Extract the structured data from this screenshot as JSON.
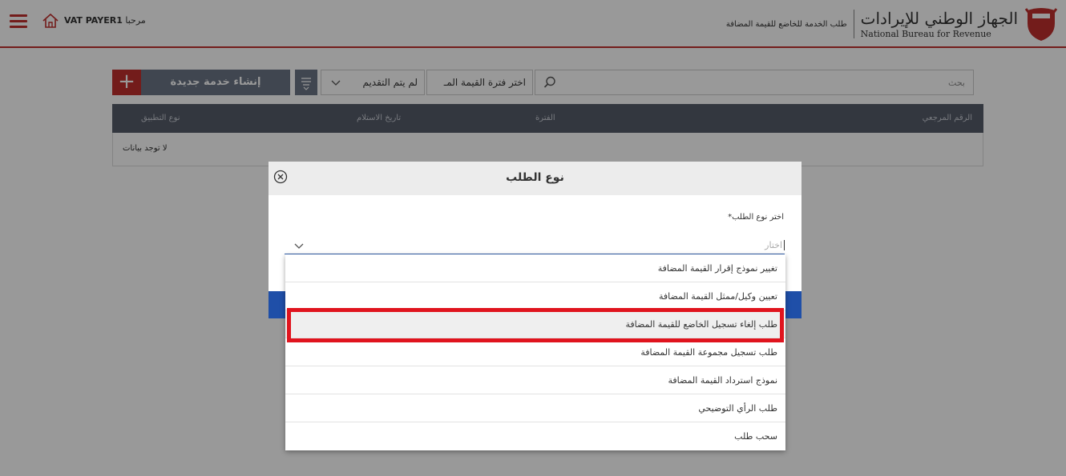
{
  "header": {
    "greeting_prefix": "مرحبا",
    "user_name": "VAT PAYER1",
    "service_title": "طلب الخدمة للخاضع للقيمة المضافة",
    "logo_ar": "الجهاز الوطني للإيرادات",
    "logo_en": "National Bureau for Revenue"
  },
  "toolbar": {
    "search_placeholder": "بحث",
    "period_value": "اختر فترة القيمة المـ",
    "status_value": "لم يتم التقديم",
    "create_label": "إنشاء خدمة جديدة",
    "plus_label": "+"
  },
  "table": {
    "columns": [
      "الرقم المرجعي",
      "الفترة",
      "تاريخ الاستلام",
      "نوع التطبيق"
    ],
    "empty_text": "لا توجد بيانات"
  },
  "modal": {
    "title": "نوع الطلب",
    "field_label": "اختر نوع الطلب*",
    "select_placeholder": "اختار",
    "options": [
      "تغيير نموذج إقرار القيمة المضافة",
      "تعيين وكيل/ممثل القيمة المضافة",
      "طلب إلغاء تسجيل الخاضع للقيمة المضافة",
      "طلب تسجيل مجموعة القيمة المضافة",
      "نموذج استرداد القيمة المضافة",
      "طلب الرأي التوضيحي",
      "سحب طلب"
    ],
    "highlighted_index": 2
  },
  "colors": {
    "brand_red": "#c0302d",
    "slate": "#6b7585",
    "table_head": "#555c6a",
    "primary_blue": "#1f4fa8",
    "highlight_border": "#e0141e"
  }
}
